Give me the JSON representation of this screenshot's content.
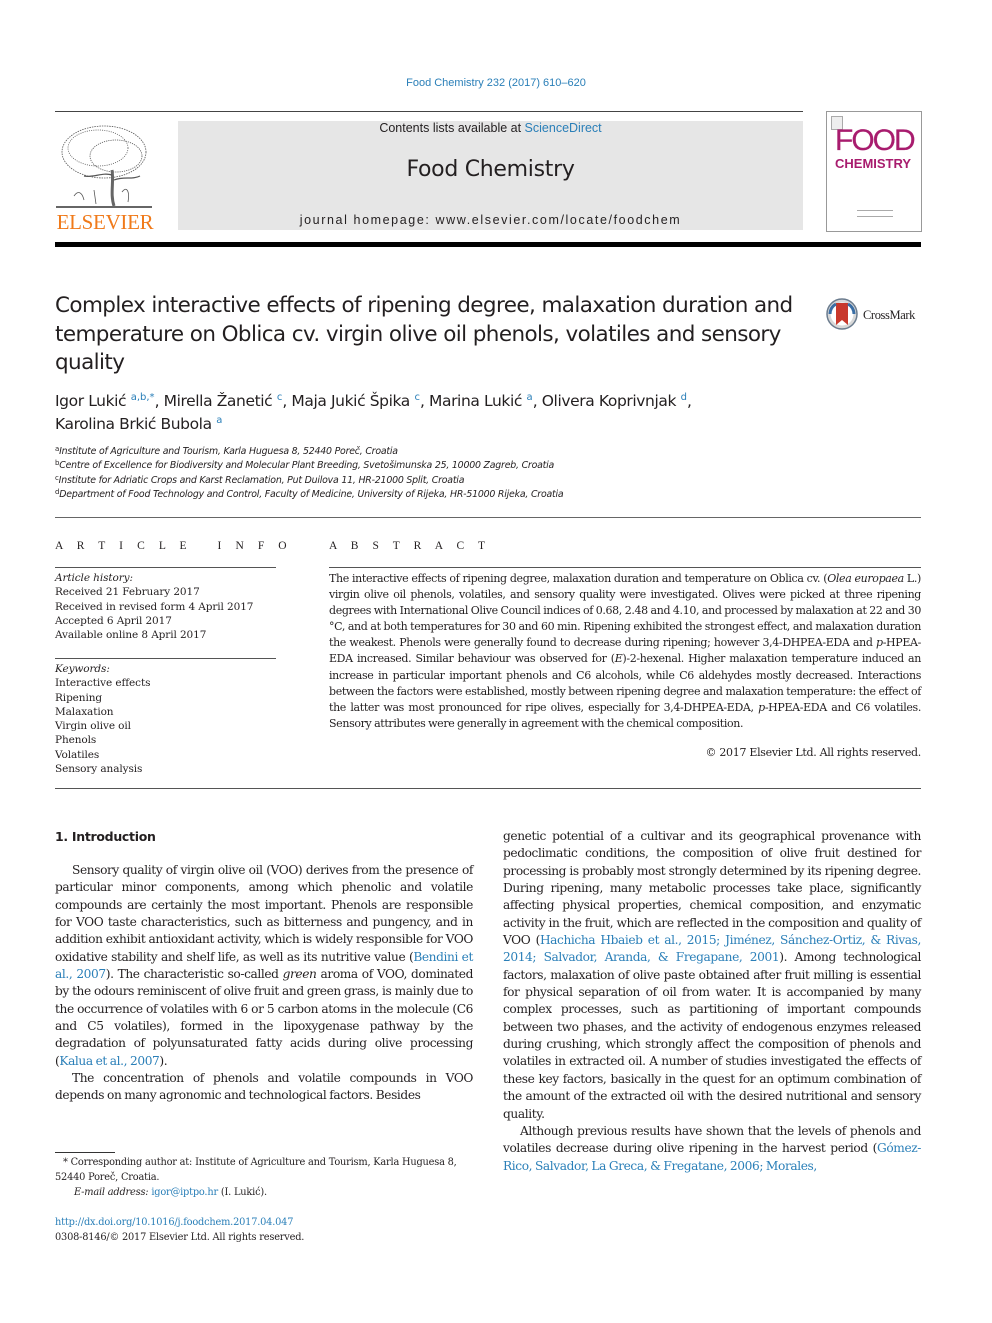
{
  "journal_ref": "Food Chemistry 232 (2017) 610–620",
  "header": {
    "publisher_logo_text": "ELSEVIER",
    "contents_prefix": "Contents lists available at ",
    "contents_link": "ScienceDirect",
    "journal_title": "Food Chemistry",
    "homepage_line": "journal homepage: www.elsevier.com/locate/foodchem",
    "cover": {
      "line1": "FOOD",
      "line2": "CHEMISTRY"
    },
    "colors": {
      "elsevier_orange": "#f07a1a",
      "link_blue": "#2a7fb8",
      "cover_magenta": "#a81c6e",
      "masthead_gray": "#e6e6e6"
    }
  },
  "article": {
    "title": "Complex interactive effects of ripening degree, malaxation duration and temperature on Oblica cv. virgin olive oil phenols, volatiles and sensory quality",
    "crossmark_label": "CrossMark",
    "authors": [
      {
        "name": "Igor Lukić",
        "sup": "a,b,*"
      },
      {
        "name": "Mirella Žanetić",
        "sup": "c"
      },
      {
        "name": "Maja Jukić Špika",
        "sup": "c"
      },
      {
        "name": "Marina Lukić",
        "sup": "a"
      },
      {
        "name": "Olivera Koprivnjak",
        "sup": "d"
      },
      {
        "name": "Karolina Brkić Bubola",
        "sup": "a"
      }
    ],
    "affiliations": [
      {
        "key": "a",
        "text": "Institute of Agriculture and Tourism, Karla Huguesa 8, 52440 Poreč, Croatia"
      },
      {
        "key": "b",
        "text": "Centre of Excellence for Biodiversity and Molecular Plant Breeding, Svetošimunska 25, 10000 Zagreb, Croatia"
      },
      {
        "key": "c",
        "text": "Institute for Adriatic Crops and Karst Reclamation, Put Duilova 11, HR-21000 Split, Croatia"
      },
      {
        "key": "d",
        "text": "Department of Food Technology and Control, Faculty of Medicine, University of Rijeka, HR-51000 Rijeka, Croatia"
      }
    ]
  },
  "article_info": {
    "label": "A R T I C L E   I N F O",
    "history_heading": "Article history:",
    "history": [
      "Received 21 February 2017",
      "Received in revised form 4 April 2017",
      "Accepted 6 April 2017",
      "Available online 8 April 2017"
    ],
    "keywords_heading": "Keywords:",
    "keywords": [
      "Interactive effects",
      "Ripening",
      "Malaxation",
      "Virgin olive oil",
      "Phenols",
      "Volatiles",
      "Sensory analysis"
    ]
  },
  "abstract": {
    "label": "A B S T R A C T",
    "parts": [
      "The interactive effects of ripening degree, malaxation duration and temperature on Oblica cv. (",
      "Olea europaea",
      " L.) virgin olive oil phenols, volatiles, and sensory quality were investigated. Olives were picked at three ripening degrees with International Olive Council indices of 0.68, 2.48 and 4.10, and processed by malaxation at 22 and 30 °C, and at both temperatures for 30 and 60 min. Ripening exhibited the strongest effect, and malaxation duration the weakest. Phenols were generally found to decrease during ripening; however 3,4-DHPEA-EDA and ",
      "p",
      "-HPEA-EDA increased. Similar behaviour was observed for (",
      "E",
      ")-2-hexenal. Higher malaxation temperature induced an increase in particular important phenols and C6 alcohols, while C6 aldehydes mostly decreased. Interactions between the factors were established, mostly between ripening degree and malaxation temperature: the effect of the latter was most pronounced for ripe olives, especially for 3,4-DHPEA-EDA, ",
      "p",
      "-HPEA-EDA and C6 volatiles. Sensory attributes were generally in agreement with the chemical composition."
    ],
    "copyright": "© 2017 Elsevier Ltd. All rights reserved."
  },
  "introduction": {
    "heading": "1. Introduction",
    "left": {
      "p1": {
        "a": "Sensory quality of virgin olive oil (VOO) derives from the presence of particular minor components, among which phenolic and volatile compounds are certainly the most important. Phenols are responsible for VOO taste characteristics, such as bitterness and pungency, and in addition exhibit antioxidant activity, which is widely responsible for VOO oxidative stability and shelf life, as well as its nutritive value (",
        "cite1": "Bendini et al., 2007",
        "b": "). The characteristic so-called ",
        "green": "green",
        "c": " aroma of VOO, dominated by the odours reminiscent of olive fruit and green grass, is mainly due to the occurrence of volatiles with 6 or 5 carbon atoms in the molecule (C6 and C5 volatiles), formed in the lipoxygenase pathway by the degradation of polyunsaturated fatty acids during olive processing (",
        "cite2": "Kalua et al., 2007",
        "d": ")."
      },
      "p2": "The concentration of phenols and volatile compounds in VOO depends on many agronomic and technological factors. Besides"
    },
    "right": {
      "p1": {
        "a": "genetic potential of a cultivar and its geographical provenance with pedoclimatic conditions, the composition of olive fruit destined for processing is probably most strongly determined by its ripening degree. During ripening, many metabolic processes take place, significantly affecting physical properties, chemical composition, and enzymatic activity in the fruit, which are reflected in the composition and quality of VOO (",
        "cite1": "Hachicha Hbaieb et al., 2015; Jiménez, Sánchez-Ortiz, & Rivas, 2014; Salvador, Aranda, & Fregapane, 2001",
        "b": "). Among technological factors, malaxation of olive paste obtained after fruit milling is essential for physical separation of oil from water. It is accompanied by many complex processes, such as partitioning of important compounds between two phases, and the activity of endogenous enzymes released during crushing, which strongly affect the composition of phenols and volatiles in extracted oil. A number of studies investigated the effects of these key factors, basically in the quest for an optimum combination of the amount of the extracted oil with the desired nutritional and sensory quality."
      },
      "p2": {
        "a": "Although previous results have shown that the levels of phenols and volatiles decrease during olive ripening in the harvest period (",
        "cite": "Gómez-Rico, Salvador, La Greca, & Fregatane, 2006; Morales,"
      }
    }
  },
  "footnotes": {
    "corresponding": "* Corresponding author at: Institute of Agriculture and Tourism, Karla Huguesa 8, 52440 Poreč, Croatia.",
    "email_label": "E-mail address:",
    "email": "igor@iptpo.hr",
    "email_suffix": " (I. Lukić).",
    "doi": "http://dx.doi.org/10.1016/j.foodchem.2017.04.047",
    "issn": "0308-8146/© 2017 Elsevier Ltd. All rights reserved."
  }
}
